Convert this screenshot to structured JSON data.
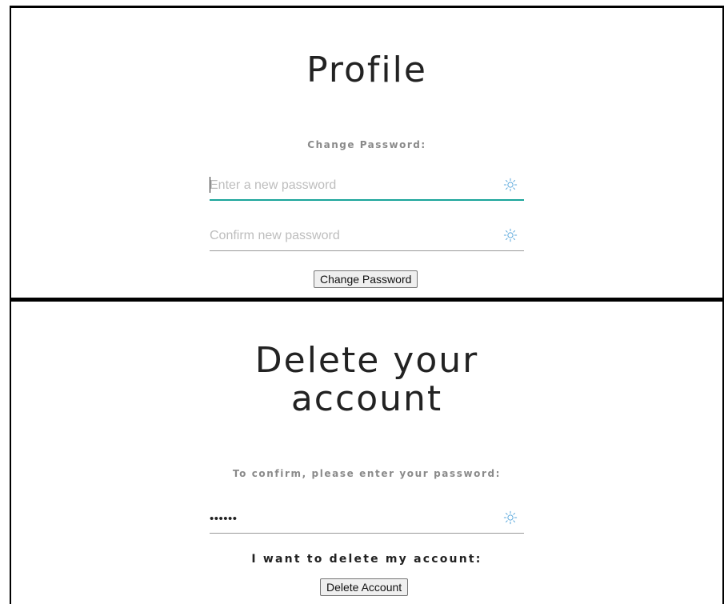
{
  "profile": {
    "title": "Profile",
    "change_password_label": "Change Password:",
    "new_password": {
      "placeholder": "Enter a new password",
      "value": ""
    },
    "confirm_password": {
      "placeholder": "Confirm new password",
      "value": ""
    },
    "change_button": "Change Password"
  },
  "delete": {
    "title_line1": "Delete your",
    "title_line2": "account",
    "confirm_label": "To confirm, please enter your password:",
    "password": {
      "value": "••••••"
    },
    "want_label": "I want to delete my account:",
    "delete_button": "Delete Account"
  },
  "icons": {
    "visibility_toggle": "sun-eye-icon"
  },
  "colors": {
    "focus_underline": "#1aa59a",
    "icon": "#4a9fd8"
  }
}
